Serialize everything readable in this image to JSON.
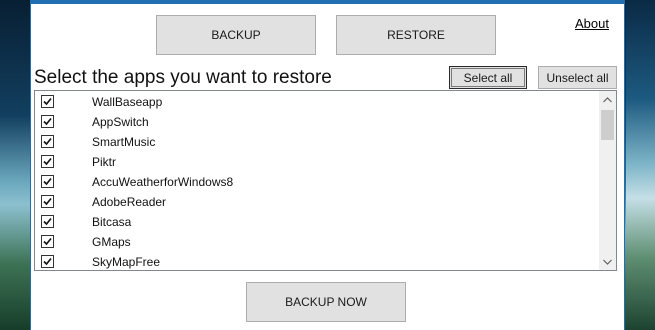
{
  "window": {
    "backup_label": "BACKUP",
    "restore_label": "RESTORE",
    "about_label": "About",
    "heading": "Select the apps you want to restore",
    "select_all_label": "Select all",
    "unselect_all_label": "Unselect all",
    "backup_now_label": "BACKUP NOW"
  },
  "apps": [
    {
      "name": "WallBaseapp",
      "checked": true
    },
    {
      "name": "AppSwitch",
      "checked": true
    },
    {
      "name": "SmartMusic",
      "checked": true
    },
    {
      "name": "Piktr",
      "checked": true
    },
    {
      "name": "AccuWeatherforWindows8",
      "checked": true
    },
    {
      "name": "AdobeReader",
      "checked": true
    },
    {
      "name": "Bitcasa",
      "checked": true
    },
    {
      "name": "GMaps",
      "checked": true
    },
    {
      "name": "SkyMapFree",
      "checked": true
    }
  ],
  "colors": {
    "window_border": "#1f6fb2",
    "button_face": "#e1e1e1"
  }
}
